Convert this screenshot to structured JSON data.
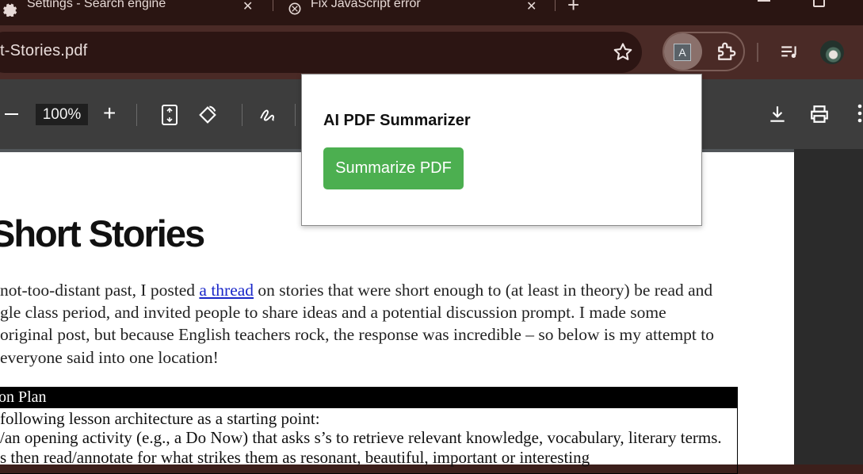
{
  "tabs": [
    {
      "title": "Settings - Search engine",
      "icon": "gear-icon"
    },
    {
      "title": "Fix JavaScript error",
      "icon": "openai-icon"
    }
  ],
  "omnibox": {
    "url_visible": "t-Stories.pdf"
  },
  "extension": {
    "badge": "A"
  },
  "pdf_toolbar": {
    "zoom": "100%"
  },
  "popup": {
    "title": "AI PDF Summarizer",
    "button_label": "Summarize PDF",
    "button_color": "#4caf50"
  },
  "document": {
    "title": "Short Stories",
    "paragraph_lines": [
      {
        "before": " not-too-distant past, I posted ",
        "link": "a thread",
        "after": " on stories that were short enough to (at least in theory) be read and"
      },
      {
        "text": "gle class period, and invited people to share ideas and a potential discussion prompt.  I made some"
      },
      {
        "text": " original post, but because English teachers rock, the response was incredible – so below is my attempt to"
      },
      {
        "text": "everyone said into one location!"
      }
    ],
    "box": {
      "heading": "on Plan",
      "lines": [
        "following lesson architecture as a starting point:",
        "/an opening activity (e.g., a Do Now) that asks s’s to retrieve relevant knowledge, vocabulary, literary terms.",
        "s then read/annotate for what strikes them as resonant, beautiful, important or interesting"
      ]
    }
  }
}
